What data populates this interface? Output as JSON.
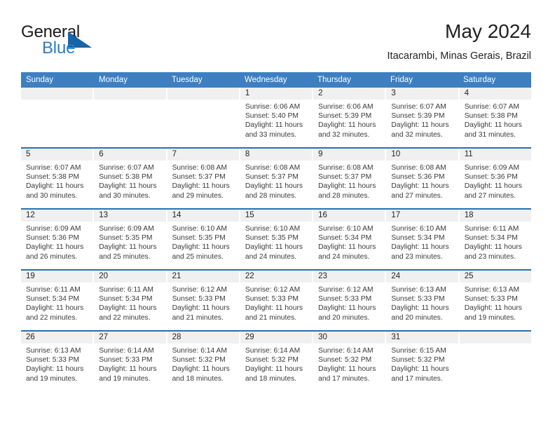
{
  "brand": {
    "word1": "General",
    "word2": "Blue",
    "triangle_color": "#1565a8",
    "blue_color": "#2b7cc4"
  },
  "header": {
    "title": "May 2024",
    "subtitle": "Itacarambi, Minas Gerais, Brazil"
  },
  "theme": {
    "header_blue": "#3d7fc1",
    "row_divider_blue": "#2a6fb0",
    "date_band_gray": "#f0f0f0"
  },
  "weekdays": [
    "Sunday",
    "Monday",
    "Tuesday",
    "Wednesday",
    "Thursday",
    "Friday",
    "Saturday"
  ],
  "weeks": [
    [
      {
        "day": "",
        "sunrise": "",
        "sunset": "",
        "daylight1": "",
        "daylight2": ""
      },
      {
        "day": "",
        "sunrise": "",
        "sunset": "",
        "daylight1": "",
        "daylight2": ""
      },
      {
        "day": "",
        "sunrise": "",
        "sunset": "",
        "daylight1": "",
        "daylight2": ""
      },
      {
        "day": "1",
        "sunrise": "Sunrise: 6:06 AM",
        "sunset": "Sunset: 5:40 PM",
        "daylight1": "Daylight: 11 hours",
        "daylight2": "and 33 minutes."
      },
      {
        "day": "2",
        "sunrise": "Sunrise: 6:06 AM",
        "sunset": "Sunset: 5:39 PM",
        "daylight1": "Daylight: 11 hours",
        "daylight2": "and 32 minutes."
      },
      {
        "day": "3",
        "sunrise": "Sunrise: 6:07 AM",
        "sunset": "Sunset: 5:39 PM",
        "daylight1": "Daylight: 11 hours",
        "daylight2": "and 32 minutes."
      },
      {
        "day": "4",
        "sunrise": "Sunrise: 6:07 AM",
        "sunset": "Sunset: 5:38 PM",
        "daylight1": "Daylight: 11 hours",
        "daylight2": "and 31 minutes."
      }
    ],
    [
      {
        "day": "5",
        "sunrise": "Sunrise: 6:07 AM",
        "sunset": "Sunset: 5:38 PM",
        "daylight1": "Daylight: 11 hours",
        "daylight2": "and 30 minutes."
      },
      {
        "day": "6",
        "sunrise": "Sunrise: 6:07 AM",
        "sunset": "Sunset: 5:38 PM",
        "daylight1": "Daylight: 11 hours",
        "daylight2": "and 30 minutes."
      },
      {
        "day": "7",
        "sunrise": "Sunrise: 6:08 AM",
        "sunset": "Sunset: 5:37 PM",
        "daylight1": "Daylight: 11 hours",
        "daylight2": "and 29 minutes."
      },
      {
        "day": "8",
        "sunrise": "Sunrise: 6:08 AM",
        "sunset": "Sunset: 5:37 PM",
        "daylight1": "Daylight: 11 hours",
        "daylight2": "and 28 minutes."
      },
      {
        "day": "9",
        "sunrise": "Sunrise: 6:08 AM",
        "sunset": "Sunset: 5:37 PM",
        "daylight1": "Daylight: 11 hours",
        "daylight2": "and 28 minutes."
      },
      {
        "day": "10",
        "sunrise": "Sunrise: 6:08 AM",
        "sunset": "Sunset: 5:36 PM",
        "daylight1": "Daylight: 11 hours",
        "daylight2": "and 27 minutes."
      },
      {
        "day": "11",
        "sunrise": "Sunrise: 6:09 AM",
        "sunset": "Sunset: 5:36 PM",
        "daylight1": "Daylight: 11 hours",
        "daylight2": "and 27 minutes."
      }
    ],
    [
      {
        "day": "12",
        "sunrise": "Sunrise: 6:09 AM",
        "sunset": "Sunset: 5:36 PM",
        "daylight1": "Daylight: 11 hours",
        "daylight2": "and 26 minutes."
      },
      {
        "day": "13",
        "sunrise": "Sunrise: 6:09 AM",
        "sunset": "Sunset: 5:35 PM",
        "daylight1": "Daylight: 11 hours",
        "daylight2": "and 25 minutes."
      },
      {
        "day": "14",
        "sunrise": "Sunrise: 6:10 AM",
        "sunset": "Sunset: 5:35 PM",
        "daylight1": "Daylight: 11 hours",
        "daylight2": "and 25 minutes."
      },
      {
        "day": "15",
        "sunrise": "Sunrise: 6:10 AM",
        "sunset": "Sunset: 5:35 PM",
        "daylight1": "Daylight: 11 hours",
        "daylight2": "and 24 minutes."
      },
      {
        "day": "16",
        "sunrise": "Sunrise: 6:10 AM",
        "sunset": "Sunset: 5:34 PM",
        "daylight1": "Daylight: 11 hours",
        "daylight2": "and 24 minutes."
      },
      {
        "day": "17",
        "sunrise": "Sunrise: 6:10 AM",
        "sunset": "Sunset: 5:34 PM",
        "daylight1": "Daylight: 11 hours",
        "daylight2": "and 23 minutes."
      },
      {
        "day": "18",
        "sunrise": "Sunrise: 6:11 AM",
        "sunset": "Sunset: 5:34 PM",
        "daylight1": "Daylight: 11 hours",
        "daylight2": "and 23 minutes."
      }
    ],
    [
      {
        "day": "19",
        "sunrise": "Sunrise: 6:11 AM",
        "sunset": "Sunset: 5:34 PM",
        "daylight1": "Daylight: 11 hours",
        "daylight2": "and 22 minutes."
      },
      {
        "day": "20",
        "sunrise": "Sunrise: 6:11 AM",
        "sunset": "Sunset: 5:34 PM",
        "daylight1": "Daylight: 11 hours",
        "daylight2": "and 22 minutes."
      },
      {
        "day": "21",
        "sunrise": "Sunrise: 6:12 AM",
        "sunset": "Sunset: 5:33 PM",
        "daylight1": "Daylight: 11 hours",
        "daylight2": "and 21 minutes."
      },
      {
        "day": "22",
        "sunrise": "Sunrise: 6:12 AM",
        "sunset": "Sunset: 5:33 PM",
        "daylight1": "Daylight: 11 hours",
        "daylight2": "and 21 minutes."
      },
      {
        "day": "23",
        "sunrise": "Sunrise: 6:12 AM",
        "sunset": "Sunset: 5:33 PM",
        "daylight1": "Daylight: 11 hours",
        "daylight2": "and 20 minutes."
      },
      {
        "day": "24",
        "sunrise": "Sunrise: 6:13 AM",
        "sunset": "Sunset: 5:33 PM",
        "daylight1": "Daylight: 11 hours",
        "daylight2": "and 20 minutes."
      },
      {
        "day": "25",
        "sunrise": "Sunrise: 6:13 AM",
        "sunset": "Sunset: 5:33 PM",
        "daylight1": "Daylight: 11 hours",
        "daylight2": "and 19 minutes."
      }
    ],
    [
      {
        "day": "26",
        "sunrise": "Sunrise: 6:13 AM",
        "sunset": "Sunset: 5:33 PM",
        "daylight1": "Daylight: 11 hours",
        "daylight2": "and 19 minutes."
      },
      {
        "day": "27",
        "sunrise": "Sunrise: 6:14 AM",
        "sunset": "Sunset: 5:33 PM",
        "daylight1": "Daylight: 11 hours",
        "daylight2": "and 19 minutes."
      },
      {
        "day": "28",
        "sunrise": "Sunrise: 6:14 AM",
        "sunset": "Sunset: 5:32 PM",
        "daylight1": "Daylight: 11 hours",
        "daylight2": "and 18 minutes."
      },
      {
        "day": "29",
        "sunrise": "Sunrise: 6:14 AM",
        "sunset": "Sunset: 5:32 PM",
        "daylight1": "Daylight: 11 hours",
        "daylight2": "and 18 minutes."
      },
      {
        "day": "30",
        "sunrise": "Sunrise: 6:14 AM",
        "sunset": "Sunset: 5:32 PM",
        "daylight1": "Daylight: 11 hours",
        "daylight2": "and 17 minutes."
      },
      {
        "day": "31",
        "sunrise": "Sunrise: 6:15 AM",
        "sunset": "Sunset: 5:32 PM",
        "daylight1": "Daylight: 11 hours",
        "daylight2": "and 17 minutes."
      },
      {
        "day": "",
        "sunrise": "",
        "sunset": "",
        "daylight1": "",
        "daylight2": ""
      }
    ]
  ]
}
